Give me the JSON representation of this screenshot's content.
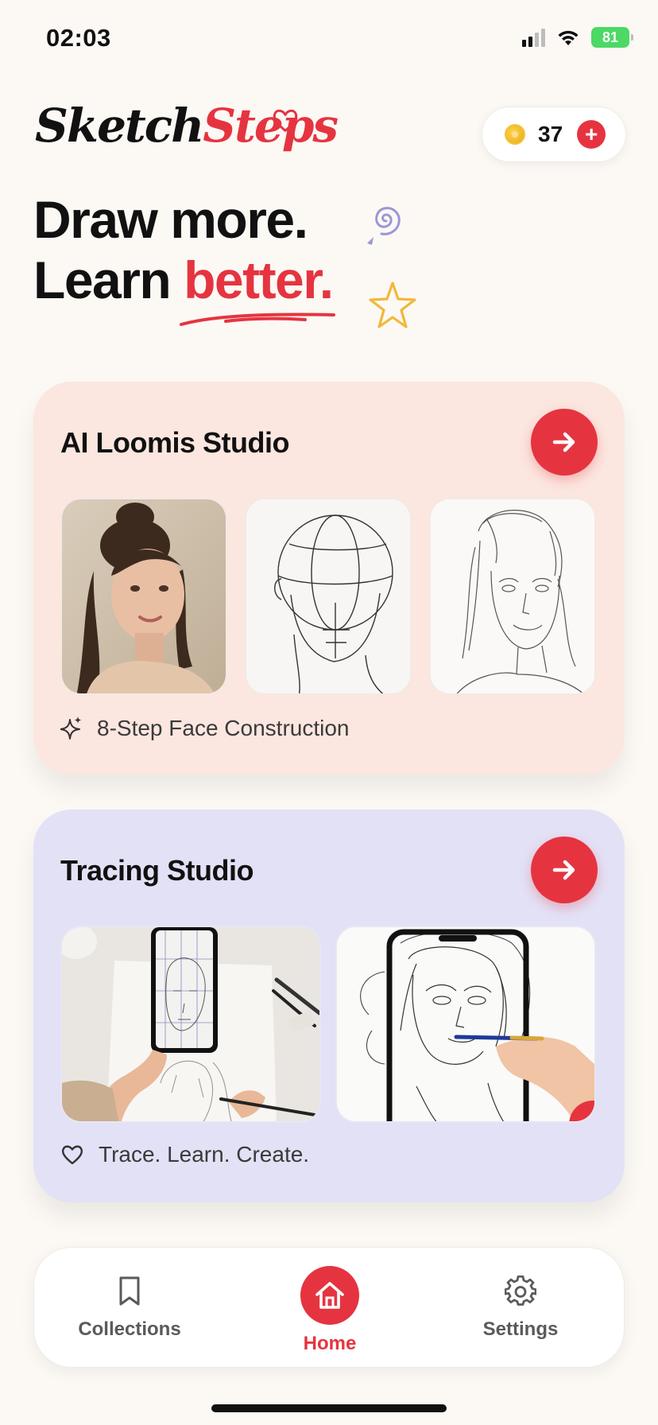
{
  "status_bar": {
    "time": "02:03",
    "battery": "81"
  },
  "header": {
    "logo_part1": "Sketch",
    "logo_part2": "Steps",
    "coins": "37",
    "add_label": "+"
  },
  "hero": {
    "line1": "Draw more.",
    "line2_prefix": "Learn ",
    "line2_accent": "better."
  },
  "cards": [
    {
      "title": "AI Loomis Studio",
      "footer_icon": "sparkle-icon",
      "footer": "8-Step Face Construction",
      "thumbnails": [
        "portrait-photo",
        "loomis-head-construction",
        "pencil-portrait-sketch"
      ]
    },
    {
      "title": "Tracing Studio",
      "footer_icon": "heart-icon",
      "footer": "Trace. Learn. Create.",
      "thumbnails": [
        "phone-tracing-photo",
        "phone-tracing-sketch"
      ]
    }
  ],
  "nav": {
    "items": [
      {
        "label": "Collections",
        "icon": "bookmark-icon"
      },
      {
        "label": "Home",
        "icon": "home-icon",
        "active": true
      },
      {
        "label": "Settings",
        "icon": "gear-icon"
      }
    ]
  },
  "colors": {
    "accent": "#E53440",
    "background": "#FCF9F5",
    "loomis_card": "#FCE6E0",
    "tracing_card": "#E3E1F6"
  }
}
